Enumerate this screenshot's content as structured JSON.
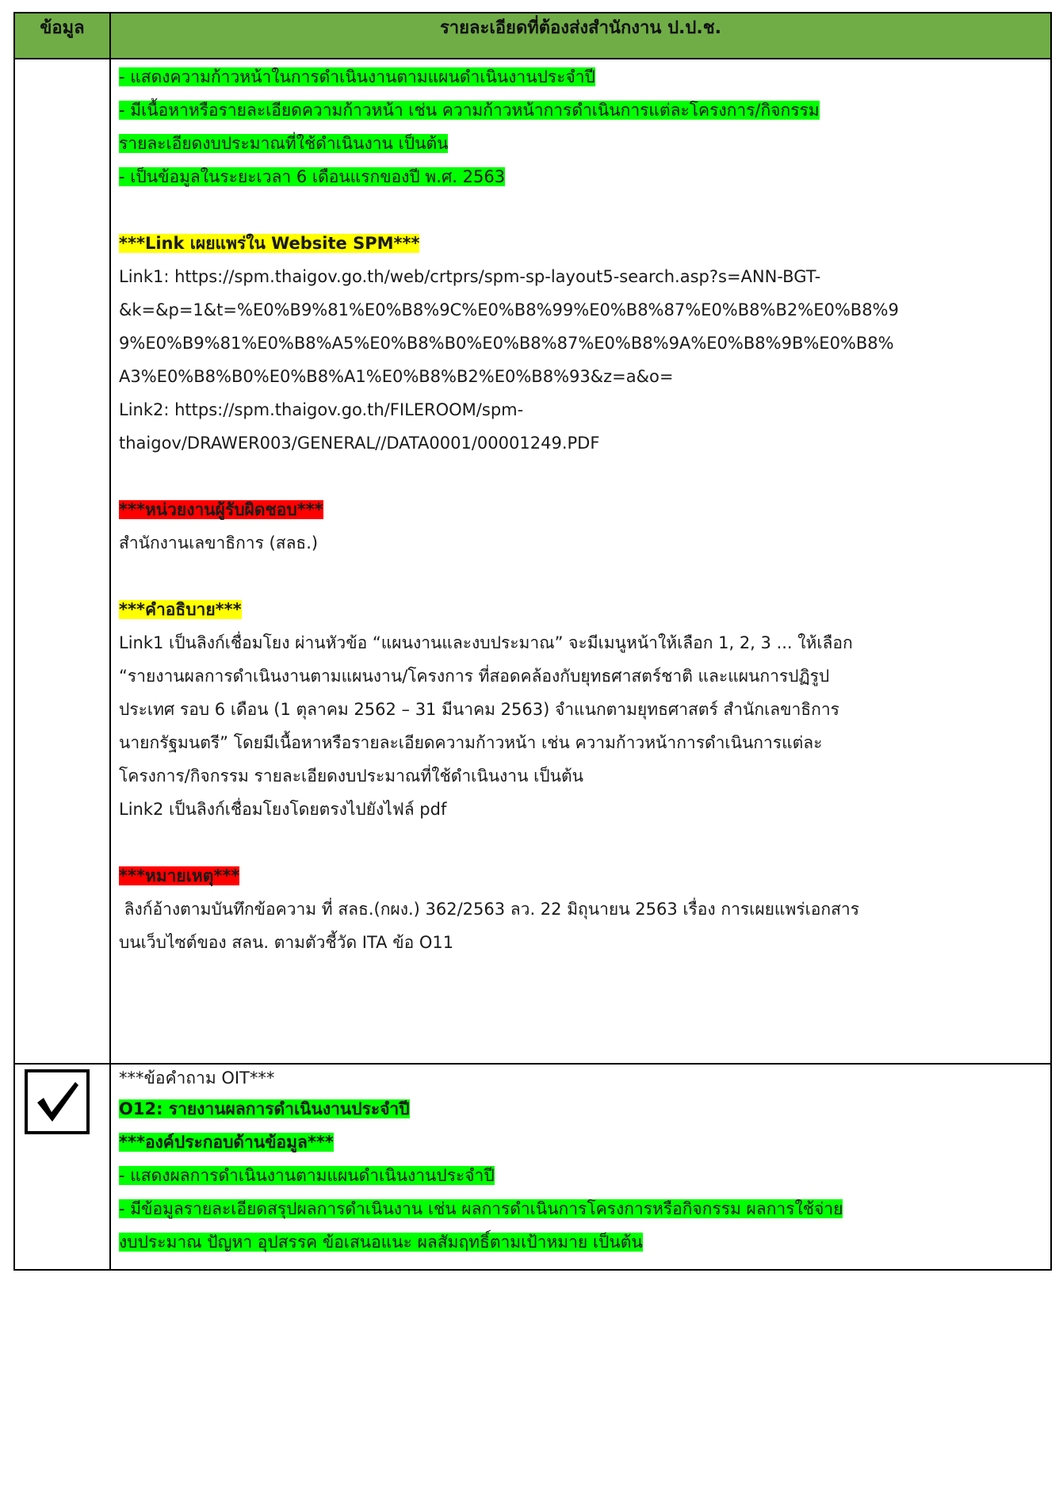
{
  "header": {
    "col1": "ข้อมูล",
    "col2": "รายละเอียดที่ต้องส่งสำนักงาน ป.ป.ช."
  },
  "row1": {
    "elements": [
      "- แสดงความก้าวหน้าในการดำเนินงานตามแผนดำเนินงานประจำปี",
      "- มีเนื้อหาหรือรายละเอียดความก้าวหน้า เช่น ความก้าวหน้าการดำเนินการแต่ละโครงการ/กิจกรรม",
      "รายละเอียดงบประมาณที่ใช้ดำเนินงาน เป็นต้น",
      "- เป็นข้อมูลในระยะเวลา 6 เดือนแรกของปี พ.ศ. 2563"
    ],
    "link_heading": "***Link เผยแพร่ใน Website SPM***",
    "link_lines": [
      "Link1: https://spm.thaigov.go.th/web/crtprs/spm-sp-layout5-search.asp?s=ANN-BGT-",
      "&k=&p=1&t=%E0%B9%81%E0%B8%9C%E0%B8%99%E0%B8%87%E0%B8%B2%E0%B8%9",
      "9%E0%B9%81%E0%B8%A5%E0%B8%B0%E0%B8%87%E0%B8%9A%E0%B8%9B%E0%B8%",
      "A3%E0%B8%B0%E0%B8%A1%E0%B8%B2%E0%B8%93&z=a&o=",
      "Link2: https://spm.thaigov.go.th/FILEROOM/spm-",
      "thaigov/DRAWER003/GENERAL//DATA0001/00001249.PDF"
    ],
    "unit_heading": "***หน่วยงานผู้รับผิดชอบ***",
    "unit_text": "สำนักงานเลขาธิการ (สลธ.)",
    "desc_heading": "***คำอธิบาย***",
    "desc_lines": [
      "Link1 เป็นลิงก์เชื่อมโยง ผ่านหัวข้อ “แผนงานและงบประมาณ” จะมีเมนูหน้าให้เลือก 1, 2, 3 ... ให้เลือก",
      "“รายงานผลการดำเนินงานตามแผนงาน/โครงการ ที่สอดคล้องกับยุทธศาสตร์ชาติ และแผนการปฏิรูป",
      "ประเทศ รอบ 6 เดือน (1 ตุลาคม 2562 – 31 มีนาคม 2563) จำแนกตามยุทธศาสตร์ สำนักเลขาธิการ",
      "นายกรัฐมนตรี” โดยมีเนื้อหาหรือรายละเอียดความก้าวหน้า เช่น ความก้าวหน้าการดำเนินการแต่ละ",
      "โครงการ/กิจกรรม รายละเอียดงบประมาณที่ใช้ดำเนินงาน เป็นต้น",
      "Link2 เป็นลิงก์เชื่อมโยงโดยตรงไปยังไฟล์ pdf"
    ],
    "note_heading": "***หมายเหตุ***",
    "note_lines": [
      " ลิงก์อ้างตามบันทึกข้อความ ที่ สลธ.(กผง.) 362/2563 ลว. 22 มิถุนายน 2563 เรื่อง การเผยแพร่เอกสาร",
      "บนเว็บไซต์ของ สลน. ตามตัวชี้วัด ITA ข้อ O11"
    ]
  },
  "row2": {
    "checkbox_icon": "check-mark-icon",
    "question_label": "***ข้อคำถาม OIT***",
    "title": "O12: รายงานผลการดำเนินงานประจำปี",
    "elements_heading": "***องค์ประกอบด้านข้อมูล***",
    "elements": [
      "- แสดงผลการดำเนินงานตามแผนดำเนินงานประจำปี",
      "- มีข้อมูลรายละเอียดสรุปผลการดำเนินงาน เช่น ผลการดำเนินการโครงการหรือกิจกรรม ผลการใช้จ่าย",
      "งบประมาณ ปัญหา อุปสรรค ข้อเสนอแนะ ผลสัมฤทธิ์ตามเป้าหมาย เป็นต้น"
    ]
  },
  "colors": {
    "header_bg": "#70ad47",
    "highlight_green": "#00ff00",
    "highlight_yellow": "#ffff00",
    "highlight_red": "#ff0000"
  }
}
